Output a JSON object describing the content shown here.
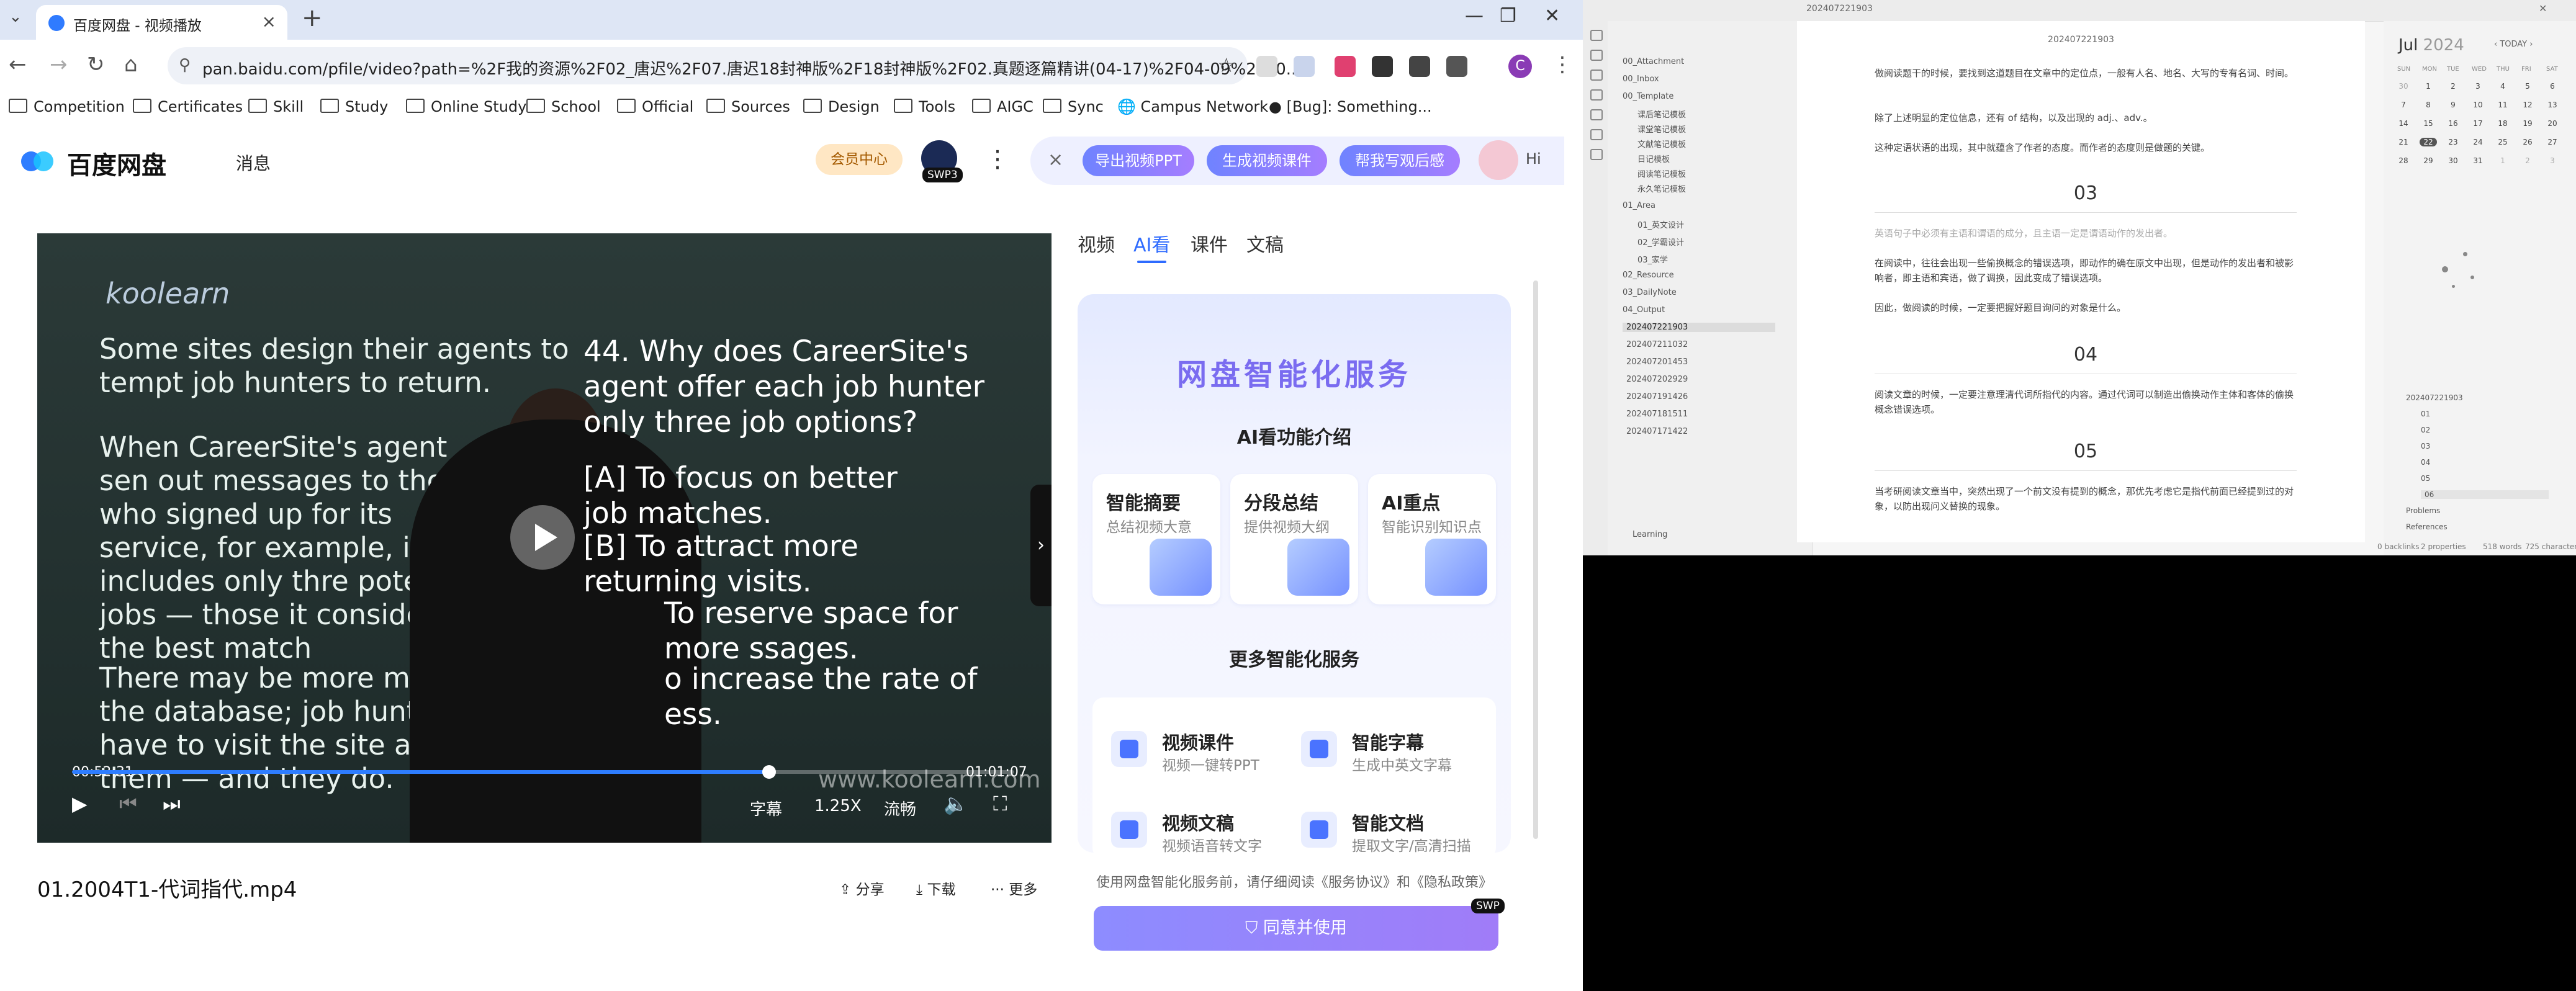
{
  "browser": {
    "tab_title": "百度网盘 - 视频播放",
    "url": "pan.baidu.com/pfile/video?path=%2F我的资源%2F02_唐迟%2F07.唐迟18封神版%2F18封神版%2F02.真题逐篇精讲(04-17)%2F04-09%2F20...",
    "avatar_letter": "C",
    "bookmarks": [
      "Competition",
      "Certificates",
      "Skill",
      "Study",
      "Online Study",
      "School",
      "Official",
      "Sources",
      "Design",
      "Tools",
      "AIGC",
      "Sync",
      "Campus Network",
      "[Bug]: Something..."
    ]
  },
  "header": {
    "logo_text": "百度网盘",
    "message": "消息",
    "vip": "会员中心",
    "swp_badge": "SWP3",
    "banner_buttons": [
      "导出视频PPT",
      "生成视频课件",
      "帮我写观后感"
    ],
    "banner_hi": "Hi"
  },
  "video": {
    "slide_logo": "koolearn",
    "bullets": [
      "Some sites design their agents to tempt job hunters to return.",
      "When CareerSite's agent sen out messages to those who signed up for its service, for example, it includes only thre potential jobs — those it considers the best match",
      "There may be more mat the database; job hunt have to visit the site ag them — and they do."
    ],
    "question": "44. Why does CareerSite's agent offer each job hunter only three job options?",
    "options": [
      "[A] To focus on better job matches.",
      "[B] To attract more returning visits.",
      "To reserve space for more ssages.",
      "o increase the rate of ess."
    ],
    "watermark": "www.koolearn.com",
    "current_time": "00:52:31",
    "total_time": "01:01:07",
    "progress": 0.74,
    "subtitle_label": "字幕",
    "speed": "1.25X",
    "quality": "流畅"
  },
  "file": {
    "name": "01.2004T1-代词指代.mp4",
    "share": "分享",
    "download": "下载",
    "more": "更多"
  },
  "side_tabs": [
    "视频",
    "AI看",
    "课件",
    "文稿"
  ],
  "ai": {
    "title": "网盘智能化服务",
    "intro": "AI看功能介绍",
    "features": [
      {
        "title": "智能摘要",
        "desc": "总结视频大意"
      },
      {
        "title": "分段总结",
        "desc": "提供视频大纲"
      },
      {
        "title": "AI重点",
        "desc": "智能识别知识点"
      }
    ],
    "more_title": "更多智能化服务",
    "services": [
      {
        "title": "视频课件",
        "desc": "视频一键转PPT"
      },
      {
        "title": "智能字幕",
        "desc": "生成中英文字幕"
      },
      {
        "title": "视频文稿",
        "desc": "视频语音转文字"
      },
      {
        "title": "智能文档",
        "desc": "提取文字/高清扫描"
      }
    ],
    "agreement": "使用网盘智能化服务前，请仔细阅读《服务协议》和《隐私政策》",
    "agree_button": "同意并使用",
    "agree_badge": "SWP"
  },
  "obsidian": {
    "tab_title": "20240722​1903",
    "note_title": "20240722​1903",
    "tree": [
      "00_Attachment",
      "00_Inbox",
      "00_Template",
      "课后笔记模板",
      "课堂笔记模板",
      "文献笔记模板",
      "日记模板",
      "阅读笔记模板",
      "永久笔记模板",
      "01_Area",
      "01_英文设计",
      "02_学霸设计",
      "03_家学",
      "02_Resource",
      "03_DailyNote",
      "04_Output",
      "202407221903",
      "20240721​1032",
      "20240720​1453",
      "20240720​2929",
      "20240719​1426",
      "20240718​1511",
      "20240717​1422"
    ],
    "vault": "Learning",
    "paragraphs": [
      "做阅读题干的时候，要找到这道题目在文章中的定位点，一般有人名、地名、大写的专有名词、时间。",
      "除了上述明显的定位信息，还有 of 结构，以及出现的 adj.、adv.。",
      "这种定语状语的出现，其中就蕴含了作者的态度。而作者的态度则是做题的关键。",
      "英语句子中必须有主语和谓语的成分，且主语一定是谓语动作的发出者。",
      "在阅读中，往往会出现一些偷换概念的错误选项，即动作的确在原文中出现，但是动作的发出者和被影响者，即主语和宾语，做了调换，因此变成了错误选项。",
      "因此，做阅读的时候，一定要把握好题目询问的对象是什么。",
      "阅读文章的时候，一定要注意理清代词所指代的内容。通过代词可以制造出偷换动作主体和客体的偷换概念错误选项。",
      "当考研阅读文章当中，突然出现了一个前文没有提到的概念，那优先考虑它是指代前面已经提到过的对象，以防出现问义替换的现象。"
    ],
    "headings": [
      "03",
      "04",
      "05"
    ],
    "calendar": {
      "month": "Jul",
      "year": "2024",
      "today_label": "TODAY",
      "dow": [
        "SUN",
        "MON",
        "TUE",
        "WED",
        "THU",
        "FRI",
        "SAT"
      ],
      "weeks": [
        [
          "30",
          "1",
          "2",
          "3",
          "4",
          "5",
          "6"
        ],
        [
          "7",
          "8",
          "9",
          "10",
          "11",
          "12",
          "13"
        ],
        [
          "14",
          "15",
          "16",
          "17",
          "18",
          "19",
          "20"
        ],
        [
          "21",
          "22",
          "23",
          "24",
          "25",
          "26",
          "27"
        ],
        [
          "28",
          "29",
          "30",
          "31",
          "1",
          "2",
          "3"
        ]
      ]
    },
    "outline": [
      "20240722​1903",
      "01",
      "02",
      "03",
      "04",
      "05",
      "06",
      "Problems",
      "References"
    ],
    "status": [
      "0 backlinks",
      "2 properties",
      "518 words",
      "725 characters"
    ]
  }
}
